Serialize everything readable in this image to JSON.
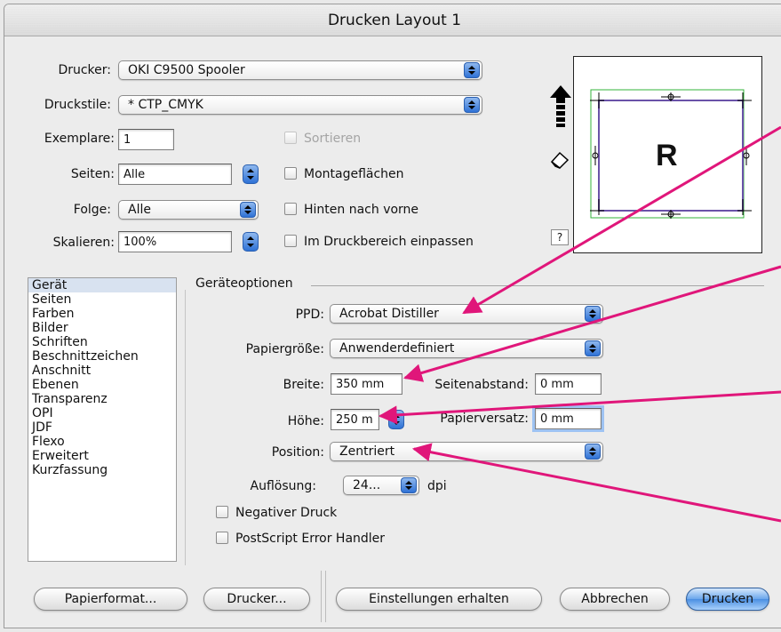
{
  "window": {
    "title": "Drucken Layout 1"
  },
  "top": {
    "printer_label": "Drucker:",
    "printer_value": "OKI C9500 Spooler",
    "style_label": "Druckstile:",
    "style_value": "* CTP_CMYK",
    "copies_label": "Exemplare:",
    "copies_value": "1",
    "collate_label": "Sortieren",
    "pages_label": "Seiten:",
    "pages_value": "Alle",
    "spreads_label": "Montageflächen",
    "order_label": "Folge:",
    "order_value": "Alle",
    "reverse_label": "Hinten nach vorne",
    "scale_label": "Skalieren:",
    "scale_value": "100%",
    "fit_label": "Im Druckbereich einpassen"
  },
  "preview": {
    "letter": "R",
    "help": "?"
  },
  "sidebar": {
    "items": [
      "Gerät",
      "Seiten",
      "Farben",
      "Bilder",
      "Schriften",
      "Beschnittzeichen",
      "Anschnitt",
      "Ebenen",
      "Transparenz",
      "OPI",
      "JDF",
      "Flexo",
      "Erweitert",
      "Kurzfassung"
    ],
    "selected": "Gerät"
  },
  "device": {
    "group_title": "Geräteoptionen",
    "ppd_label": "PPD:",
    "ppd_value": "Acrobat Distiller",
    "paper_label": "Papiergröße:",
    "paper_value": "Anwenderdefiniert",
    "width_label": "Breite:",
    "width_value": "350 mm",
    "page_gap_label": "Seitenabstand:",
    "page_gap_value": "0 mm",
    "height_label": "Höhe:",
    "height_value": "250 m",
    "paper_offset_label": "Papierversatz:",
    "paper_offset_value": "0 mm",
    "position_label": "Position:",
    "position_value": "Zentriert",
    "resolution_label": "Auflösung:",
    "resolution_value": "24...",
    "resolution_unit": "dpi",
    "negative_label": "Negativer Druck",
    "error_handler_label": "PostScript Error Handler"
  },
  "buttons": {
    "page_setup": "Papierformat...",
    "printer": "Drucker...",
    "save_settings": "Einstellungen erhalten",
    "cancel": "Abbrechen",
    "print": "Drucken"
  },
  "colors": {
    "annotation": "#e0167a",
    "accent": "#3f82dc",
    "selection": "#d8e2f0"
  }
}
